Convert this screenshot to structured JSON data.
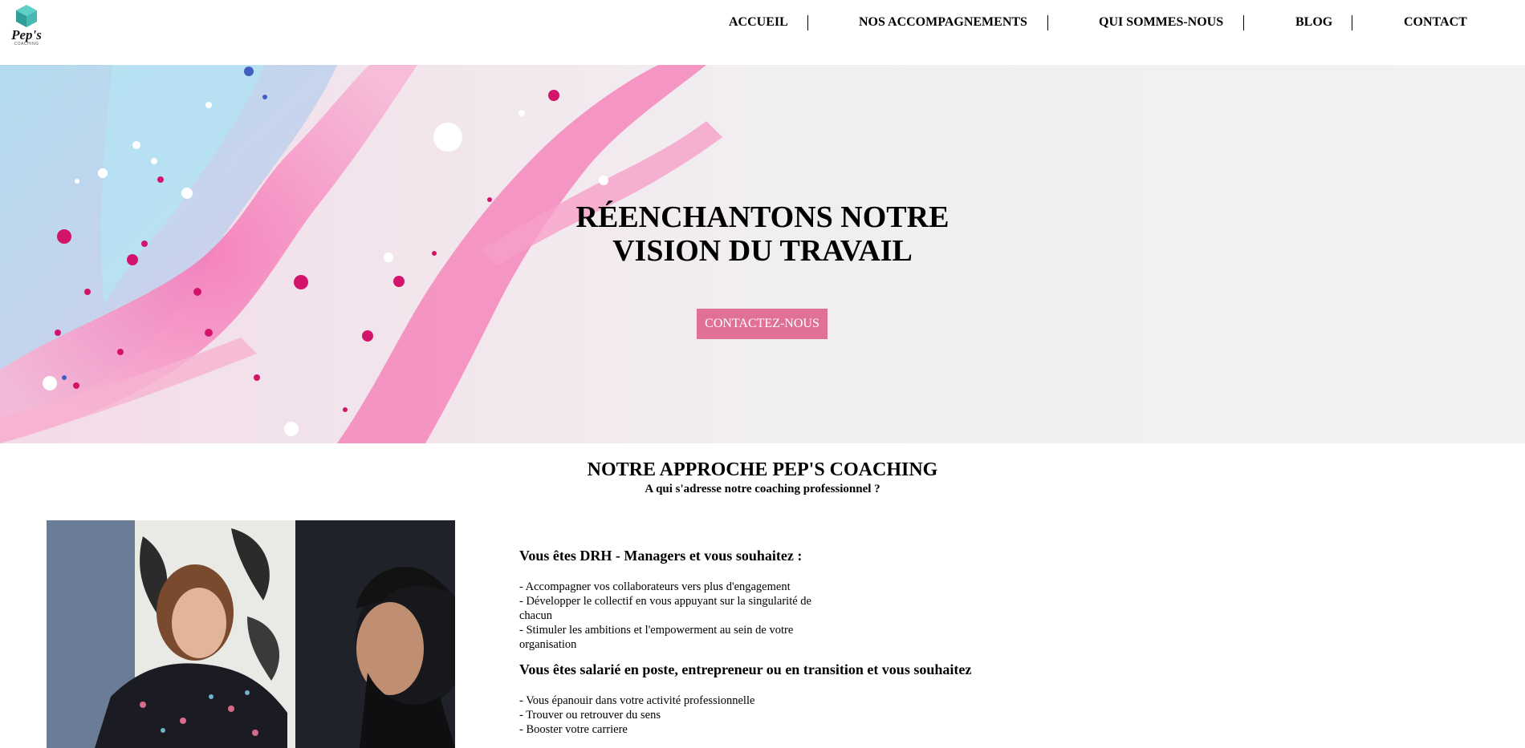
{
  "header": {
    "logo_text": "Pep's",
    "logo_sub": "COACHING",
    "nav": [
      "ACCUEIL",
      "NOS ACCOMPAGNEMENTS",
      "QUI SOMMES-NOUS",
      "BLOG",
      "CONTACT"
    ]
  },
  "hero": {
    "title_line1": "RÉENCHANTONS NOTRE",
    "title_line2": "VISION DU TRAVAIL",
    "cta": "CONTACTEZ-NOUS"
  },
  "approach": {
    "title": "NOTRE APPROCHE PEP'S COACHING",
    "subtitle": "A qui s'adresse notre coaching professionnel ?"
  },
  "blocks": [
    {
      "heading": "Vous êtes DRH - Managers et vous souhaitez :",
      "items": [
        "-  Accompagner vos collaborateurs vers plus d'engagement",
        "-  Développer le collectif en vous appuyant sur la singularité de chacun",
        "-  Stimuler les ambitions et l'empowerment au sein de votre organisation"
      ]
    },
    {
      "heading": "Vous êtes salarié en poste, entrepreneur ou en transition et vous souhaitez",
      "items": [
        "-  Vous épanouir dans votre activité professionnelle",
        "-  Trouver ou retrouver du sens",
        "-  Booster votre carriere"
      ]
    }
  ],
  "colors": {
    "cta_bg": "#e07094",
    "logo_teal": "#3bb4b0"
  }
}
